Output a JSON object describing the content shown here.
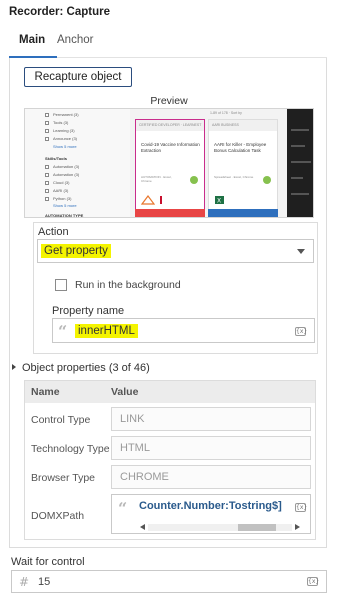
{
  "title": "Recorder: Capture",
  "tabs": [
    {
      "label": "Main",
      "active": true
    },
    {
      "label": "Anchor",
      "active": false
    }
  ],
  "recapture_label": "Recapture object",
  "preview": {
    "label": "Preview",
    "sidebar_rows": [
      "Permanent (3)",
      "Tools (3)",
      "Learning (3)",
      "Announce (3)",
      "Show 5 more",
      "Skills/Tools",
      "Automation (3)",
      "Automation (3)",
      "Cloud (3)",
      "AARI (3)",
      "Python (3)",
      "Show 5 more",
      "AUTOMATION TYPE"
    ],
    "card_a": {
      "header": "CERTIFIED DEVELOPER · LEARNEST",
      "title": "Covid-19 Vaccine Information Extraction",
      "meta": "AUTOMATION · Excel, Chrome"
    },
    "card_b": {
      "header": "AARI BUSINESS",
      "title": "AARI for Killer - Employee Bonus Calculation Task",
      "meta": "Spreadsheet · Excel, Chrome"
    },
    "top_right_text": "1-89 of 178 · Sort by"
  },
  "action": {
    "label": "Action",
    "value": "Get property",
    "run_in_background_label": "Run in the background",
    "run_in_background": false,
    "property_name_label": "Property name",
    "property_name_value": "innerHTML"
  },
  "object_properties": {
    "label": "Object properties (3 of 46)",
    "columns": [
      "Name",
      "Value"
    ],
    "rows": [
      {
        "name": "Control Type",
        "value": "LINK"
      },
      {
        "name": "Technology Type",
        "value": "HTML"
      },
      {
        "name": "Browser Type",
        "value": "CHROME"
      },
      {
        "name": "DOMXPath",
        "value": "Counter.Number:Tostring$]"
      }
    ]
  },
  "wait": {
    "label": "Wait for control",
    "value": "15"
  },
  "colors": {
    "highlight": "#f4f400",
    "accent": "#2e6fbd",
    "xpath_text": "#2a5a8c"
  },
  "icons": {
    "text_value": "quote-icon",
    "variable": "fx-icon",
    "number": "hash-icon",
    "dropdown": "chevron-down-icon",
    "expand": "caret-right-icon"
  }
}
